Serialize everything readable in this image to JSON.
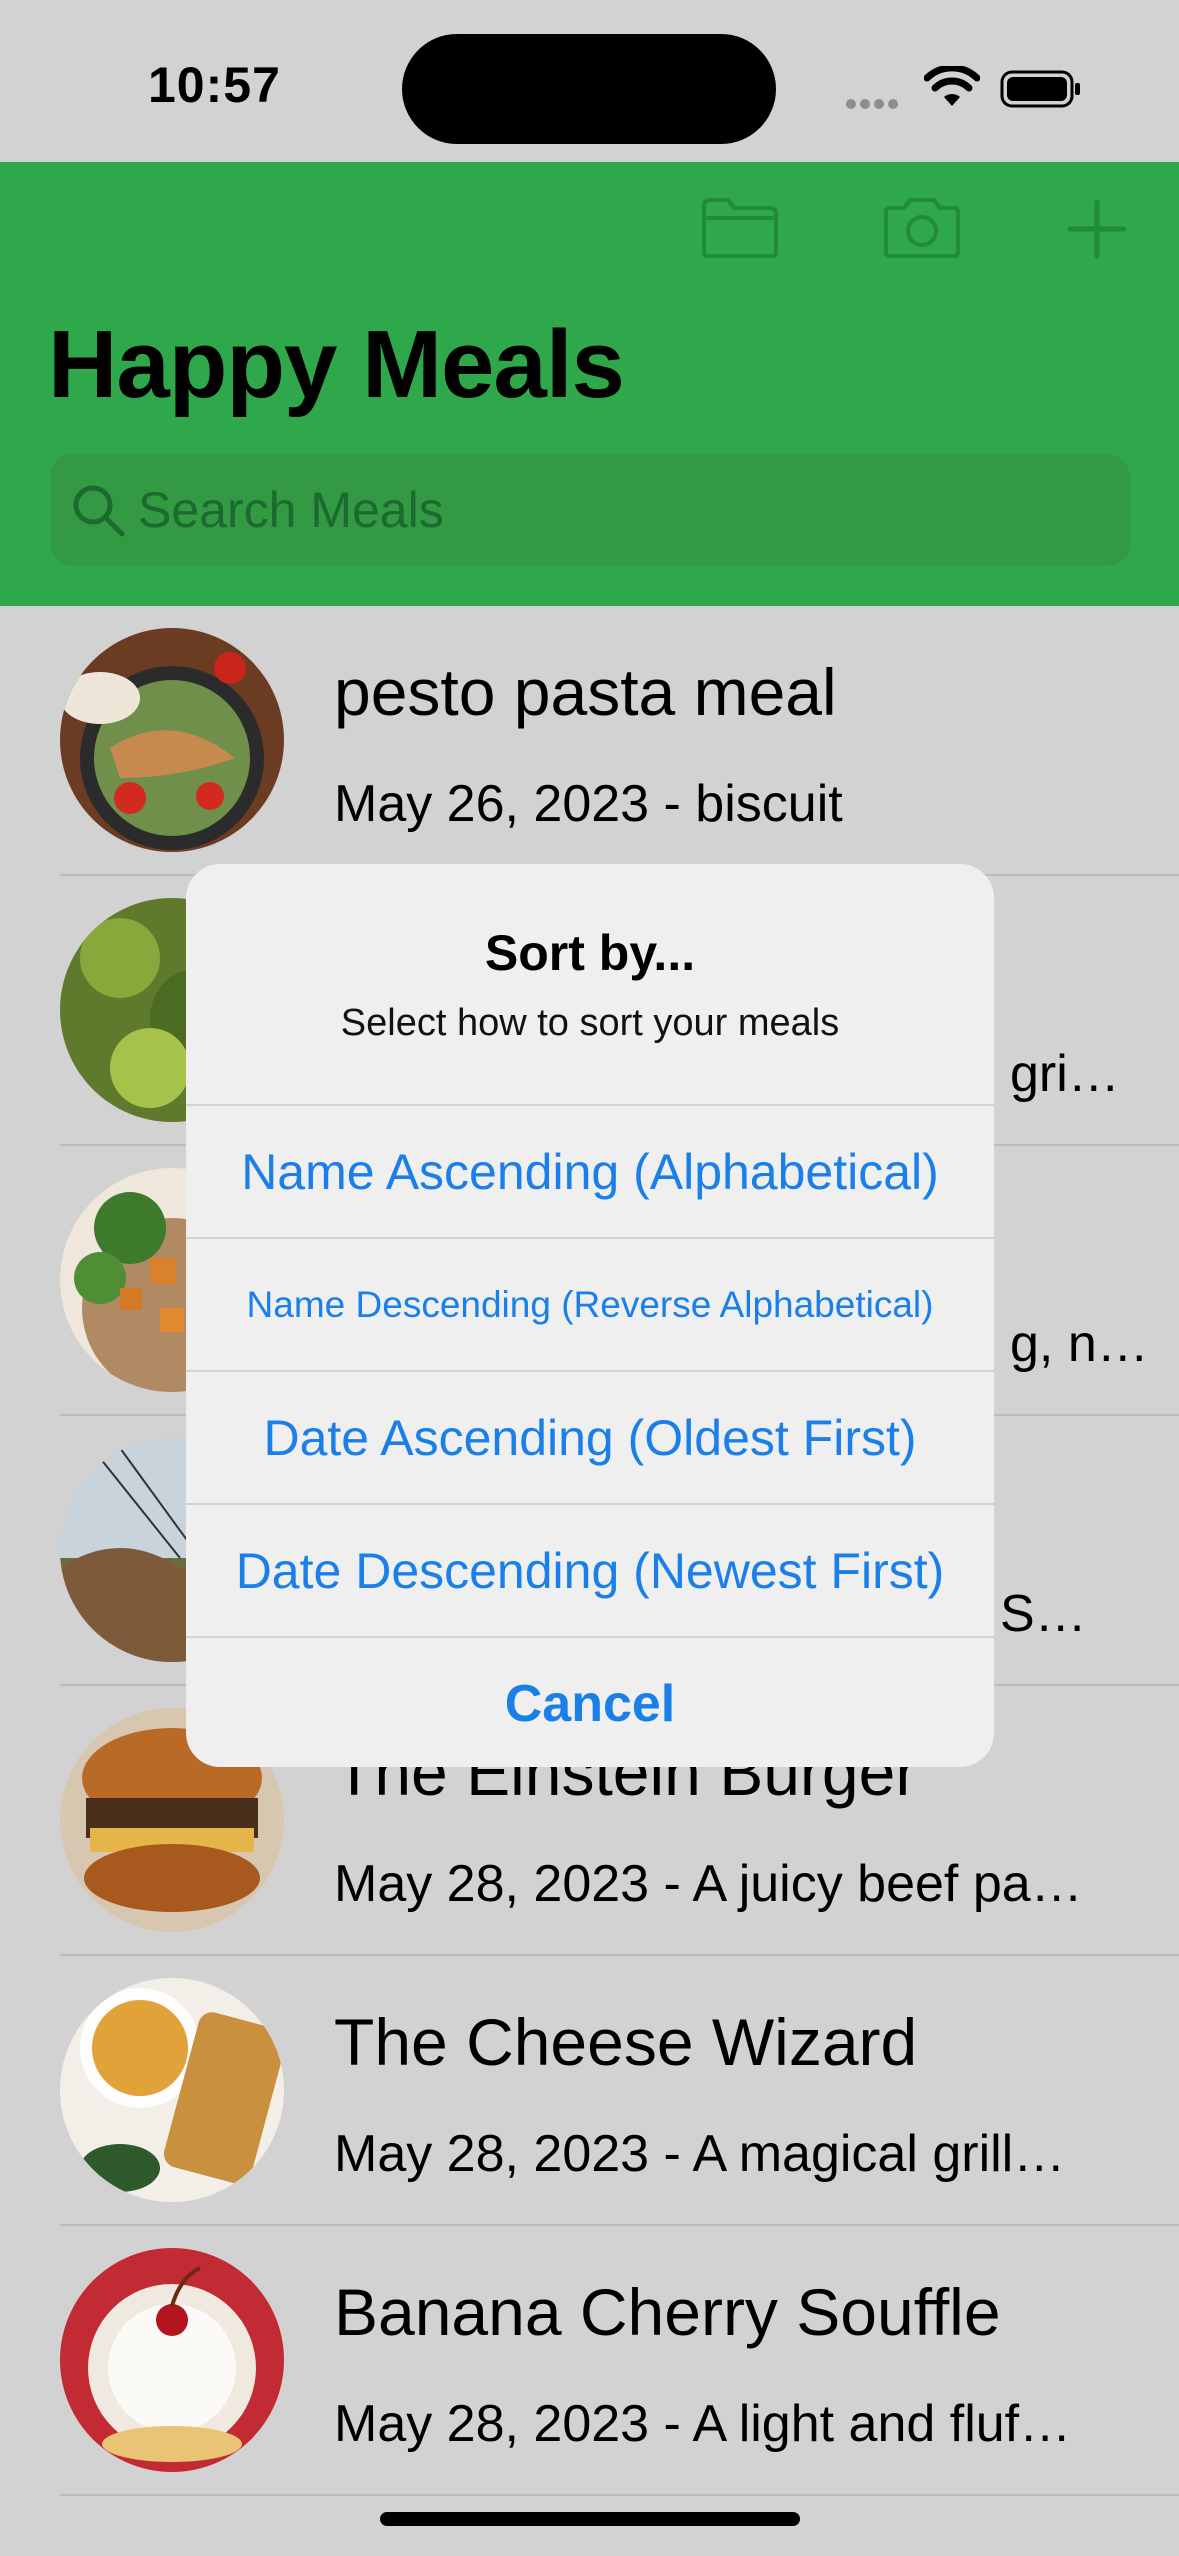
{
  "status_bar": {
    "time": "10:57"
  },
  "header": {
    "title": "Happy Meals",
    "search_placeholder": "Search Meals",
    "background_color": "#2ea84a"
  },
  "meals": [
    {
      "name": "pesto pasta meal",
      "subtitle": "May 26, 2023 - biscuit"
    },
    {
      "name": "",
      "subtitle": "gri…"
    },
    {
      "name": "",
      "subtitle": "g, n…"
    },
    {
      "name": "",
      "subtitle": "S…"
    },
    {
      "name": "The Einstein Burger",
      "subtitle": "May 28, 2023 - A juicy beef pa…"
    },
    {
      "name": "The Cheese Wizard",
      "subtitle": "May 28, 2023 - A magical grill…"
    },
    {
      "name": "Banana Cherry Souffle",
      "subtitle": "May 28, 2023 - A light and fluf…"
    }
  ],
  "sort_dialog": {
    "title": "Sort by...",
    "message": "Select how to sort your meals",
    "options": [
      "Name Ascending (Alphabetical)",
      "Name Descending (Reverse Alphabetical)",
      "Date Ascending (Oldest First)",
      "Date Descending (Newest First)"
    ],
    "cancel": "Cancel",
    "accent_color": "#1a7fe8"
  }
}
